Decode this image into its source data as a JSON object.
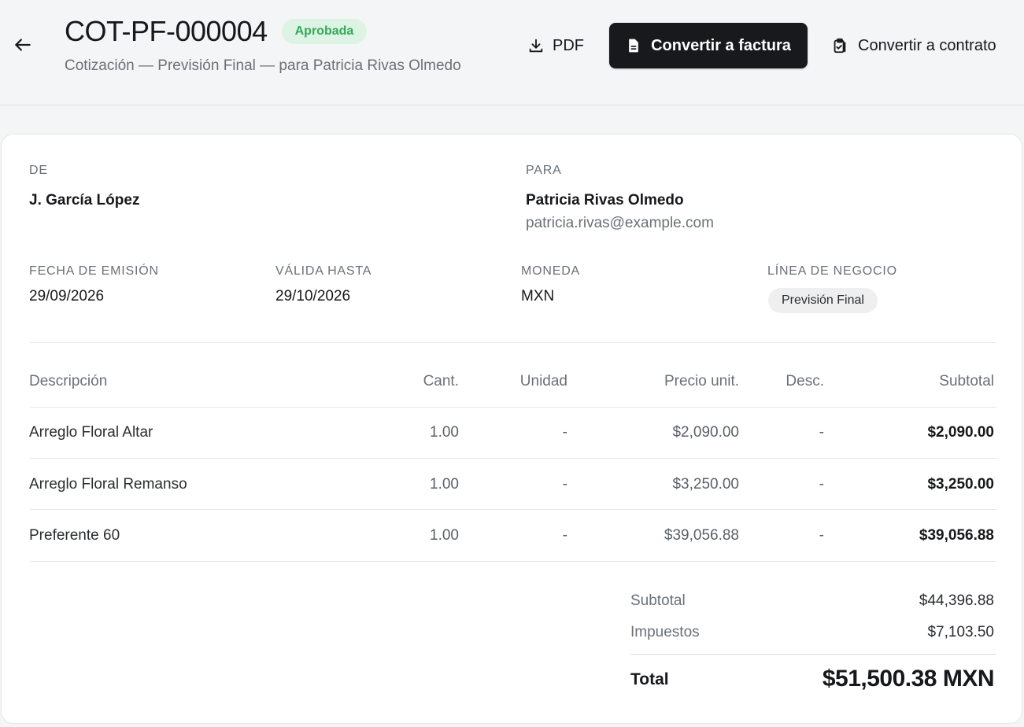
{
  "header": {
    "title": "COT-PF-000004",
    "status": "Aprobada",
    "subtitle": "Cotización — Previsión Final — para Patricia Rivas Olmedo",
    "pdf_label": "PDF",
    "invoice_label": "Convertir a factura",
    "contract_label": "Convertir a contrato"
  },
  "parties": {
    "from_label": "DE",
    "from_name": "J. García López",
    "to_label": "PARA",
    "to_name": "Patricia Rivas Olmedo",
    "to_email": "patricia.rivas@example.com"
  },
  "meta": {
    "issue_label": "FECHA DE EMISIÓN",
    "issue_value": "29/09/2026",
    "valid_label": "VÁLIDA HASTA",
    "valid_value": "29/10/2026",
    "currency_label": "MONEDA",
    "currency_value": "MXN",
    "business_label": "LÍNEA DE NEGOCIO",
    "business_value": "Previsión Final"
  },
  "table": {
    "columns": [
      "Descripción",
      "Cant.",
      "Unidad",
      "Precio unit.",
      "Desc.",
      "Subtotal"
    ],
    "rows": [
      [
        "Arreglo Floral Altar",
        "1.00",
        "-",
        "$2,090.00",
        "-",
        "$2,090.00"
      ],
      [
        "Arreglo Floral Remanso",
        "1.00",
        "-",
        "$3,250.00",
        "-",
        "$3,250.00"
      ],
      [
        "Preferente 60",
        "1.00",
        "-",
        "$39,056.88",
        "-",
        "$39,056.88"
      ]
    ]
  },
  "summary": {
    "subtotal_label": "Subtotal",
    "subtotal_value": "$44,396.88",
    "tax_label": "Impuestos",
    "tax_value": "$7,103.50",
    "total_label": "Total",
    "total_value": "$51,500.38 MXN"
  },
  "colors": {
    "status_bg": "#ddf3e3",
    "status_text": "#36a85a",
    "primary_button": "#18191c"
  },
  "icons": {
    "back": "arrow-left-icon",
    "pdf": "download-icon",
    "invoice": "document-icon",
    "contract": "clipboard-check-icon"
  }
}
